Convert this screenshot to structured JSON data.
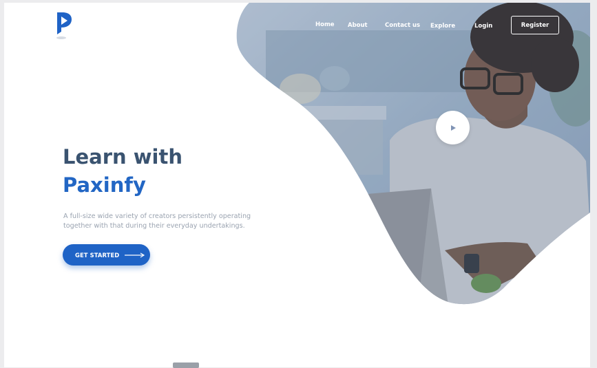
{
  "nav": {
    "home": "Home",
    "about": "About",
    "contact": "Contact us",
    "explore": "Explore",
    "login": "Login",
    "register": "Register"
  },
  "hero": {
    "title_line1": "Learn with",
    "title_line2": "Paxinfy",
    "description": "A full-size wide variety of creators persistently operating together with that during their everyday undertakings.",
    "cta_label": "GET STARTED"
  },
  "icons": {
    "logo": "paxinfy-logo-icon",
    "play": "play-icon",
    "arrow": "arrow-right-icon"
  },
  "colors": {
    "primary": "#1f63c6",
    "heading": "#3a5370",
    "photo_tint": "#7f93b4"
  }
}
